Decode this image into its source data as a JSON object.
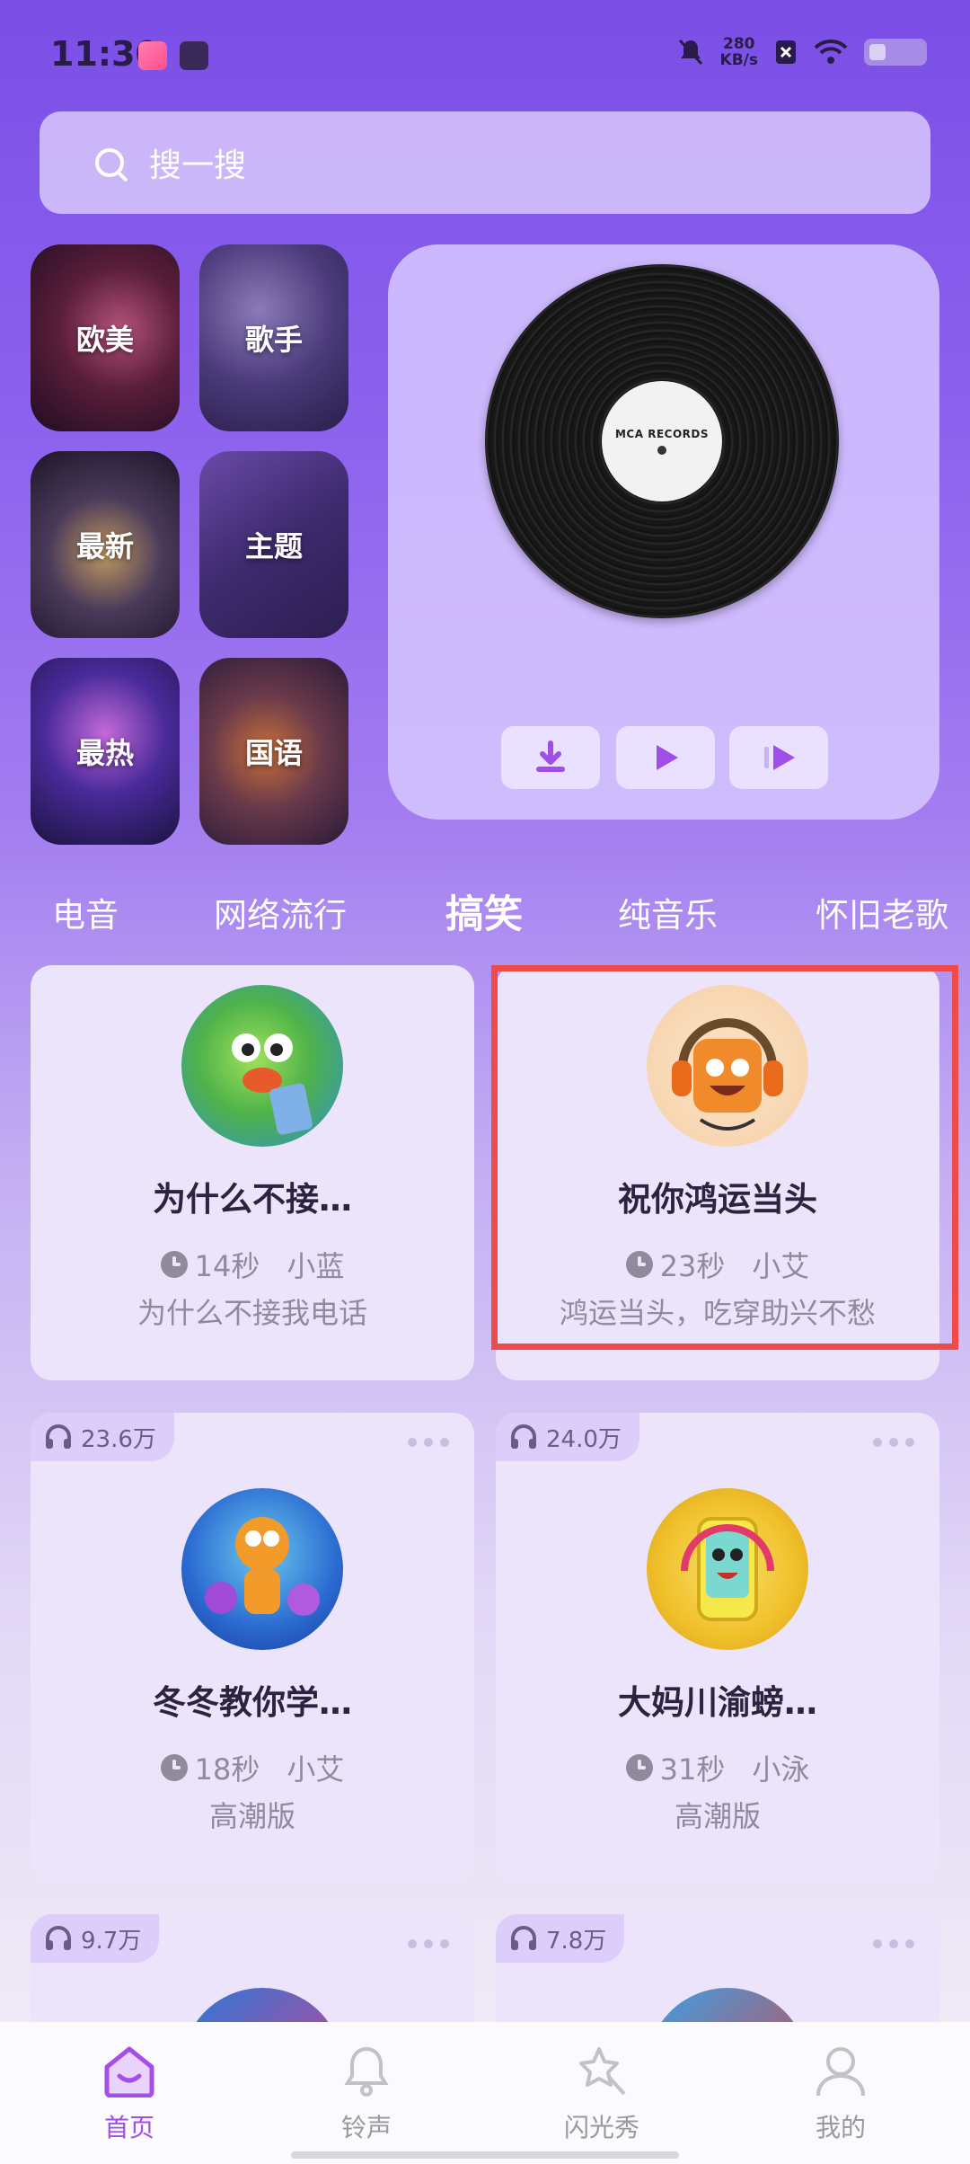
{
  "status_bar": {
    "time": "11:30",
    "net_speed_value": "280",
    "net_speed_unit": "KB/s"
  },
  "search": {
    "placeholder": "搜一搜"
  },
  "categories": [
    {
      "label": "欧美"
    },
    {
      "label": "歌手"
    },
    {
      "label": "最新"
    },
    {
      "label": "主题"
    },
    {
      "label": "最热"
    },
    {
      "label": "国语"
    }
  ],
  "player": {
    "record_label": "MCA RECORDS"
  },
  "tabs": [
    "电音",
    "网络流行",
    "搞笑",
    "纯音乐",
    "怀旧老歌"
  ],
  "active_tab": "搞笑",
  "cards": [
    {
      "title": "为什么不接…",
      "duration": "14秒",
      "author": "小蓝",
      "desc": "为什么不接我电话"
    },
    {
      "title": "祝你鸿运当头",
      "duration": "23秒",
      "author": "小艾",
      "desc": "鸿运当头，吃穿助兴不愁"
    },
    {
      "plays": "23.6万",
      "title": "冬冬教你学…",
      "duration": "18秒",
      "author": "小艾",
      "desc": "高潮版"
    },
    {
      "plays": "24.0万",
      "title": "大妈川渝螃…",
      "duration": "31秒",
      "author": "小泳",
      "desc": "高潮版"
    },
    {
      "plays": "9.7万"
    },
    {
      "plays": "7.8万"
    }
  ],
  "bottom_nav": [
    {
      "label": "首页",
      "active": true
    },
    {
      "label": "铃声"
    },
    {
      "label": "闪光秀"
    },
    {
      "label": "我的"
    }
  ],
  "colors": {
    "accent": "#9f4fe8",
    "highlight_border": "#ef4b4b"
  }
}
